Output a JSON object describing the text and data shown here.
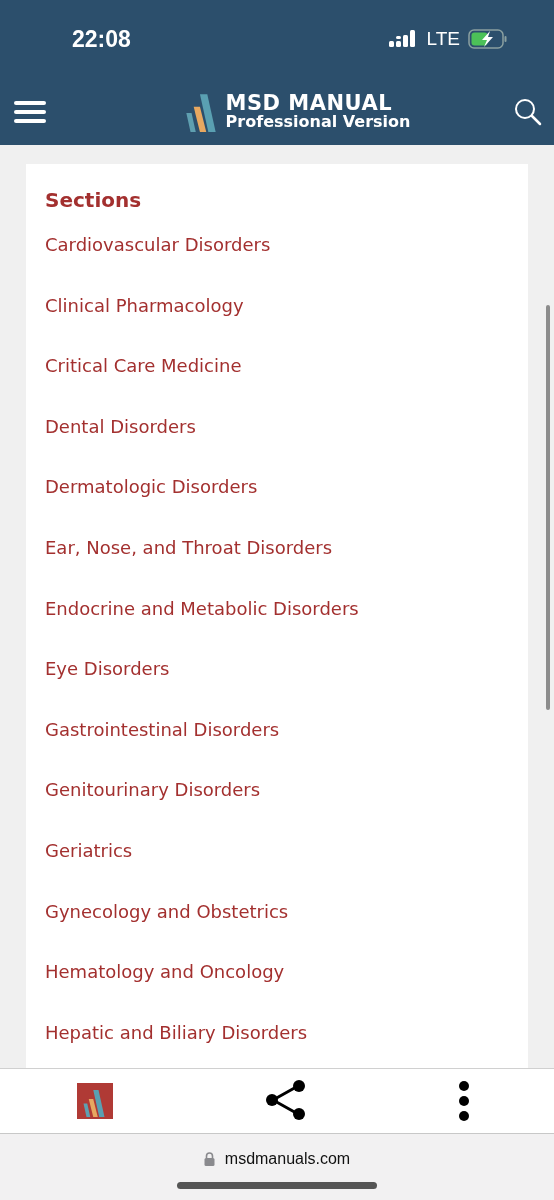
{
  "status_bar": {
    "time": "22:08",
    "network": "LTE"
  },
  "header": {
    "brand": "MSD MANUAL",
    "edition": "Professional Version"
  },
  "sections": {
    "heading": "Sections",
    "items": [
      "Cardiovascular Disorders",
      "Clinical Pharmacology",
      "Critical Care Medicine",
      "Dental Disorders",
      "Dermatologic Disorders",
      "Ear, Nose, and Throat Disorders",
      "Endocrine and Metabolic Disorders",
      "Eye Disorders",
      "Gastrointestinal Disorders",
      "Genitourinary Disorders",
      "Geriatrics",
      "Gynecology and Obstetrics",
      "Hematology and Oncology",
      "Hepatic and Biliary Disorders"
    ]
  },
  "address_bar": {
    "domain": "msdmanuals.com"
  }
}
